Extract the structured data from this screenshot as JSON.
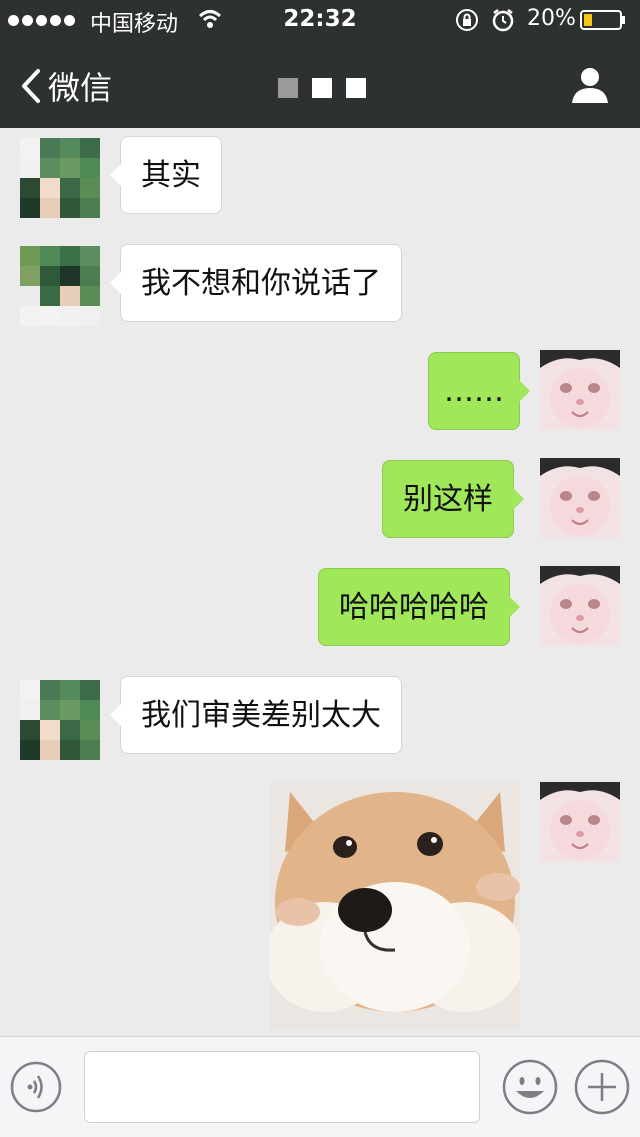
{
  "status_bar": {
    "carrier": "中国移动",
    "time": "22:32",
    "battery": "20%"
  },
  "nav": {
    "back_label": "微信"
  },
  "messages": [
    {
      "side": "in",
      "text": "其实"
    },
    {
      "side": "in",
      "text": "我不想和你说话了"
    },
    {
      "side": "out",
      "text": "……"
    },
    {
      "side": "out",
      "text": "别这样"
    },
    {
      "side": "out",
      "text": "哈哈哈哈哈"
    },
    {
      "side": "in",
      "text": "我们审美差别太大"
    },
    {
      "side": "out",
      "image": "shiba-dog-sticker"
    }
  ],
  "input": {
    "placeholder": ""
  },
  "colors": {
    "header_bg": "#2e3132",
    "chat_bg": "#ebebeb",
    "outgoing_bubble": "#a0e75a",
    "incoming_bubble": "#ffffff"
  },
  "icons": [
    "wifi-icon",
    "lock-rotation-icon",
    "alarm-icon",
    "battery-icon",
    "back-chevron-icon",
    "contact-icon",
    "voice-icon",
    "emoji-icon",
    "plus-icon"
  ]
}
